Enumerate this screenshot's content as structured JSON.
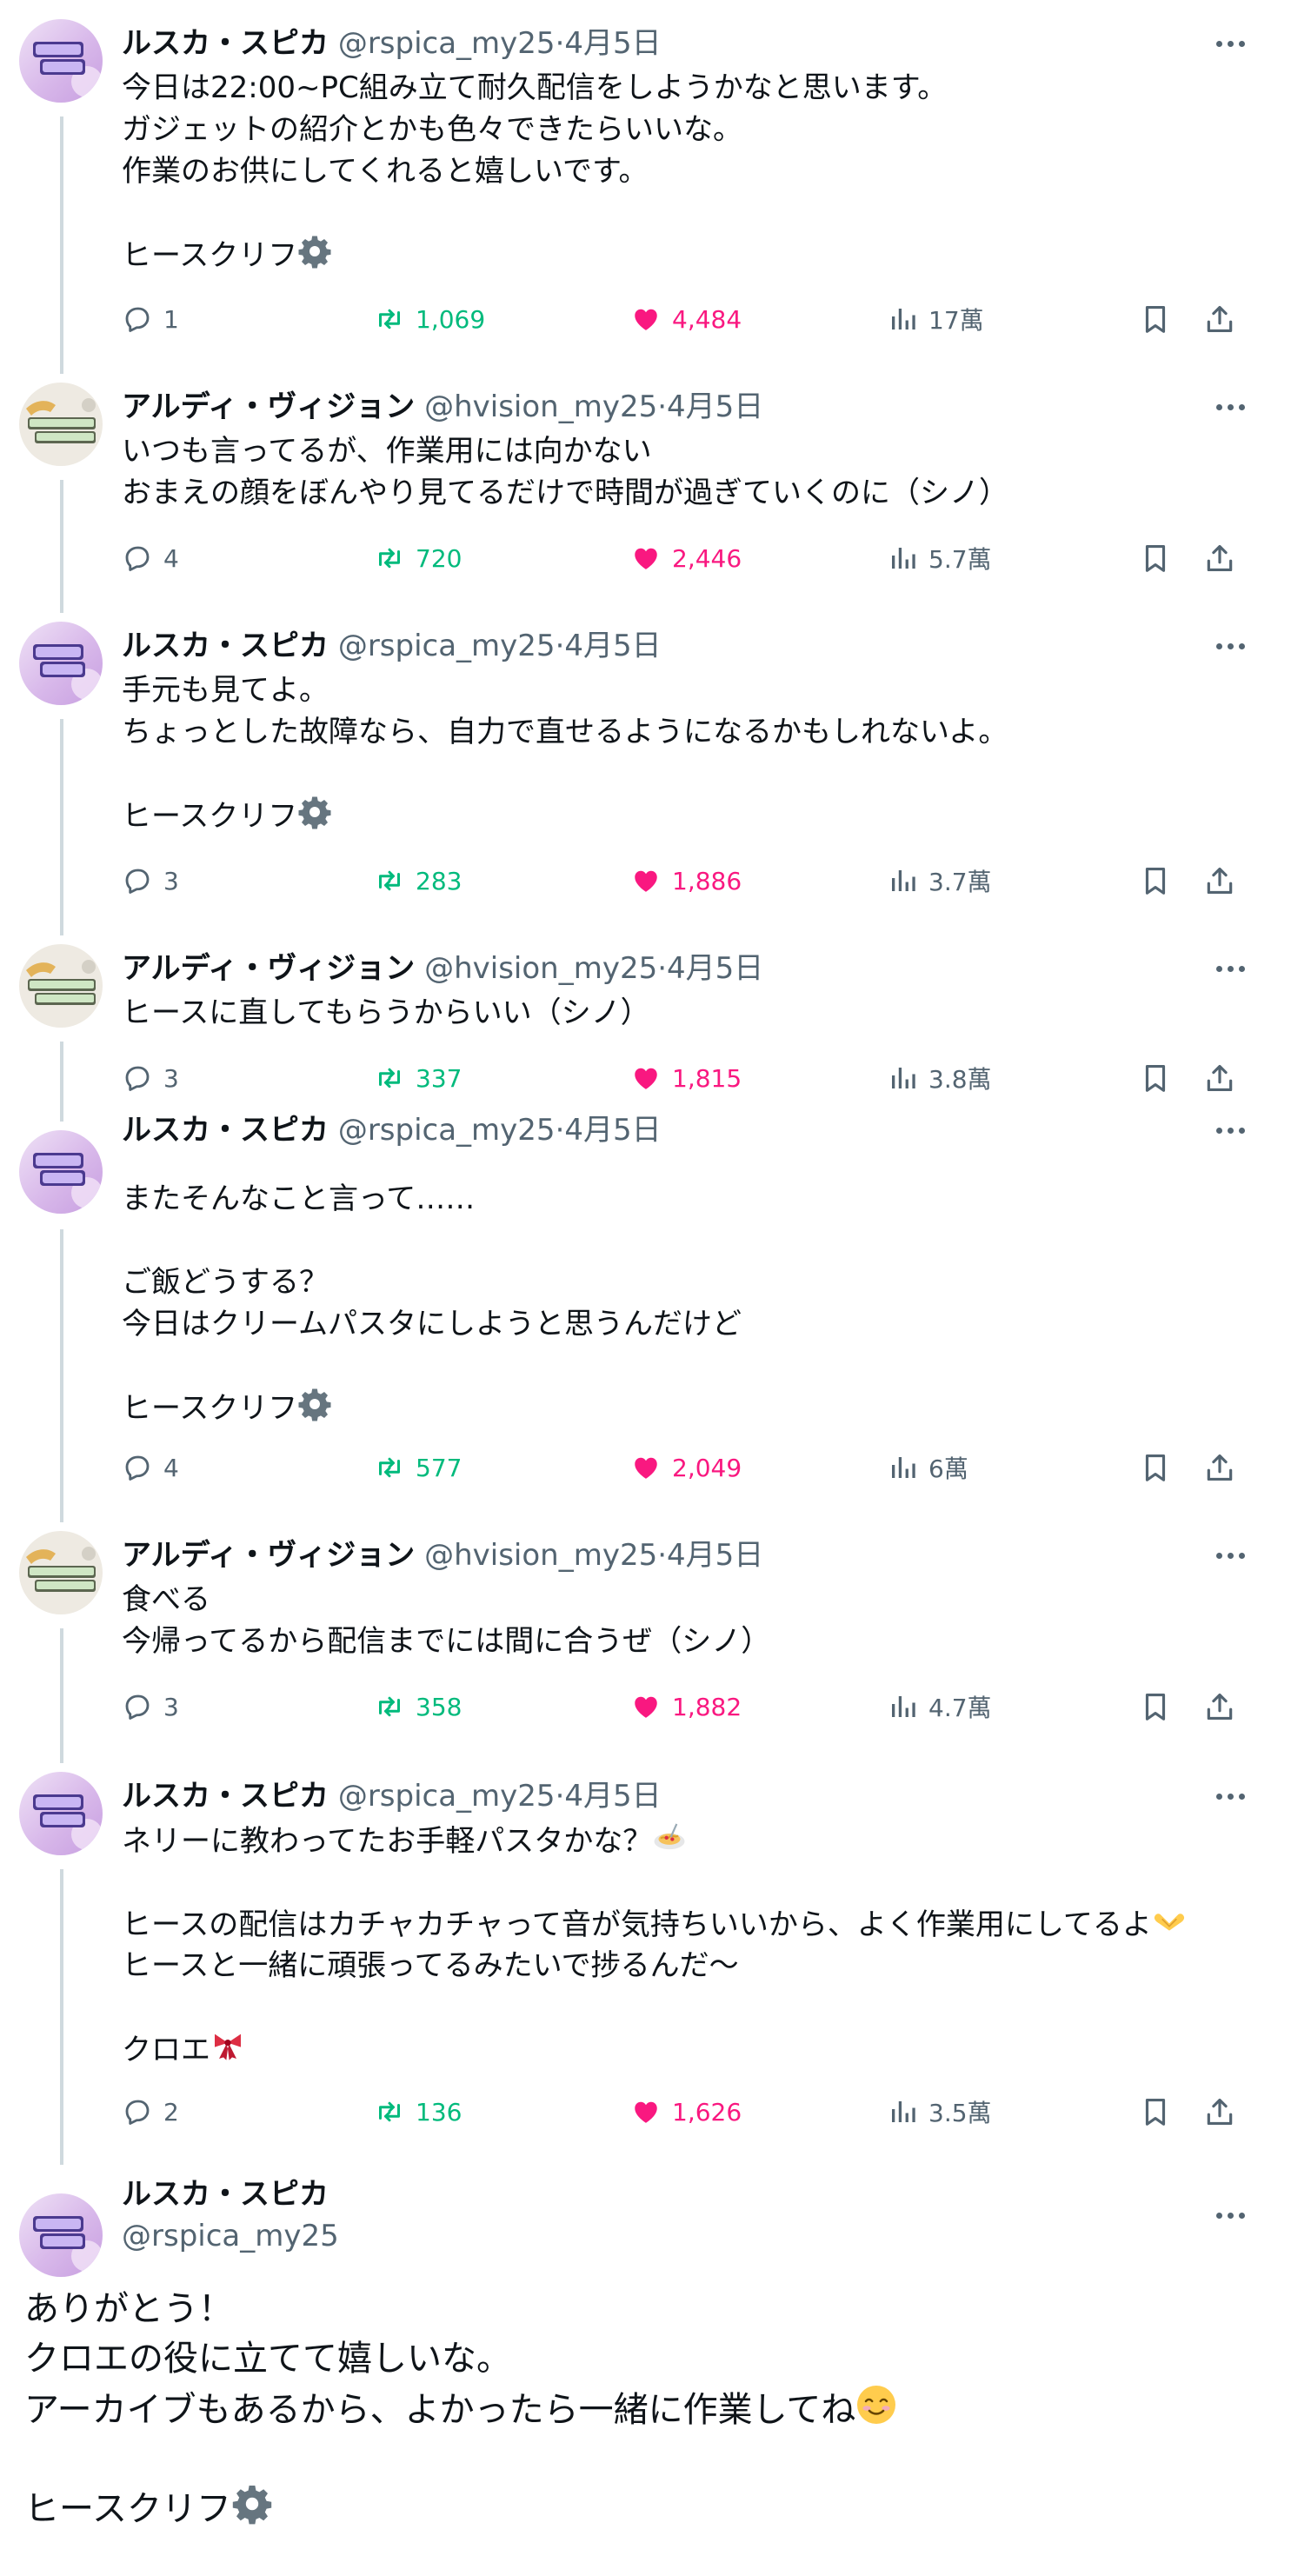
{
  "posts": [
    {
      "name": "ルスカ・スピカ",
      "handle": "@rspica_my25",
      "sep": "·",
      "date": "4月5日",
      "lines": [
        "今日は22:00~PC組み立て耐久配信をしようかなと思います。",
        "ガジェットの紹介とかも色々できたらいいな。",
        "作業のお供にしてくれると嬉しいです。",
        "",
        "ヒースクリフ"
      ],
      "reply": "1",
      "retweet": "1,069",
      "like": "4,484",
      "views": "17萬"
    },
    {
      "name": "アルディ・ヴィジョン",
      "handle": "@hvision_my25",
      "sep": "·",
      "date": "4月5日",
      "lines": [
        "いつも言ってるが、作業用には向かない",
        "おまえの顔をぼんやり見てるだけで時間が過ぎていくのに（シノ）"
      ],
      "reply": "4",
      "retweet": "720",
      "like": "2,446",
      "views": "5.7萬"
    },
    {
      "name": "ルスカ・スピカ",
      "handle": "@rspica_my25",
      "sep": "·",
      "date": "4月5日",
      "lines": [
        "手元も見てよ。",
        "ちょっとした故障なら、自力で直せるようになるかもしれないよ。",
        "",
        "ヒースクリフ"
      ],
      "reply": "3",
      "retweet": "283",
      "like": "1,886",
      "views": "3.7萬"
    },
    {
      "name": "アルディ・ヴィジョン",
      "handle": "@hvision_my25",
      "sep": "·",
      "date": "4月5日",
      "lines": [
        "ヒースに直してもらうからいい（シノ）"
      ],
      "reply": "3",
      "retweet": "337",
      "like": "1,815",
      "views": "3.8萬"
    },
    {
      "name": "ルスカ・スピカ",
      "handle": "@rspica_my25",
      "sep": "·",
      "date": "4月5日",
      "lines": [
        "またそんなこと言って……",
        "",
        "ご飯どうする？",
        "今日はクリームパスタにしようと思うんだけど",
        "",
        "ヒースクリフ"
      ],
      "reply": "4",
      "retweet": "577",
      "like": "2,049",
      "views": "6萬"
    },
    {
      "name": "アルディ・ヴィジョン",
      "handle": "@hvision_my25",
      "sep": "·",
      "date": "4月5日",
      "lines": [
        "食べる",
        "今帰ってるから配信までには間に合うぜ（シノ）"
      ],
      "reply": "3",
      "retweet": "358",
      "like": "1,882",
      "views": "4.7萬"
    },
    {
      "name": "ルスカ・スピカ",
      "handle": "@rspica_my25",
      "sep": "·",
      "date": "4月5日",
      "lines": [
        "ネリーに教わってたお手軽パスタかな？",
        "",
        "ヒースの配信はカチャカチャって音が気持ちいいから、よく作業用にしてるよ",
        "ヒースと一緒に頑張ってるみたいで捗るんだ～",
        "",
        "クロエ"
      ],
      "reply": "2",
      "retweet": "136",
      "like": "1,626",
      "views": "3.5萬"
    }
  ],
  "final": {
    "name": "ルスカ・スピカ",
    "handle": "@rspica_my25",
    "lines": [
      "ありがとう！",
      "クロエの役に立てて嬉しいな。",
      "アーカイブもあるから、よかったら一緒に作業してね",
      "",
      "ヒースクリフ"
    ]
  },
  "icons": {
    "more": "more-dots-icon",
    "reply": "reply-bubble-icon",
    "retweet": "retweet-icon",
    "like": "heart-icon",
    "views": "views-bar-icon",
    "bookmark": "bookmark-icon",
    "share": "share-icon",
    "gear": "gear-emoji",
    "spaghetti": "spaghetti-emoji",
    "heart_hands": "heart-hands-emoji",
    "ribbon": "ribbon-emoji",
    "smile": "smiling-face-emoji"
  },
  "colors": {
    "retweet": "#00ba7c",
    "like": "#f91880",
    "muted": "#536471",
    "text": "#0f1419",
    "thread": "#cfd9de"
  }
}
